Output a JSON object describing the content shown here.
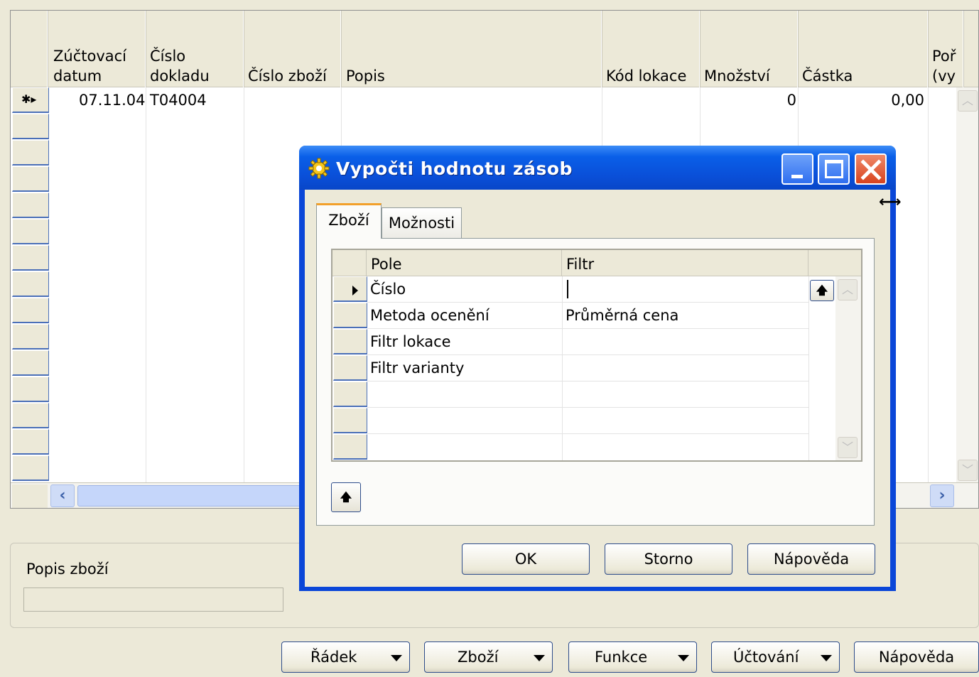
{
  "journal": {
    "columns": [
      "Zúčtovací\ndatum",
      "Číslo\ndokladu",
      "Číslo zboží",
      "Popis",
      "Kód lokace",
      "Množství",
      "Částka",
      "Poř\n(vy"
    ],
    "row": {
      "marker": "✱▸",
      "date": "07.11.04",
      "document_no": "T04004",
      "quantity": "0",
      "amount": "0,00"
    }
  },
  "item_description_panel": {
    "label": "Popis zboží",
    "value": ""
  },
  "bottom_buttons": [
    "Řádek",
    "Zboží",
    "Funkce",
    "Účtování",
    "Nápověda"
  ],
  "dialog": {
    "title": "Vypočti hodnotu zásob",
    "tabs": [
      "Zboží",
      "Možnosti"
    ],
    "active_tab": "Zboží",
    "grid_headers": [
      "Pole",
      "Filtr"
    ],
    "rows": [
      {
        "field": "Číslo",
        "filter": ""
      },
      {
        "field": "Metoda ocenění",
        "filter": "Průměrná cena"
      },
      {
        "field": "Filtr lokace",
        "filter": ""
      },
      {
        "field": "Filtr varianty",
        "filter": ""
      }
    ],
    "buttons": {
      "ok": "OK",
      "cancel": "Storno",
      "help": "Nápověda"
    }
  }
}
